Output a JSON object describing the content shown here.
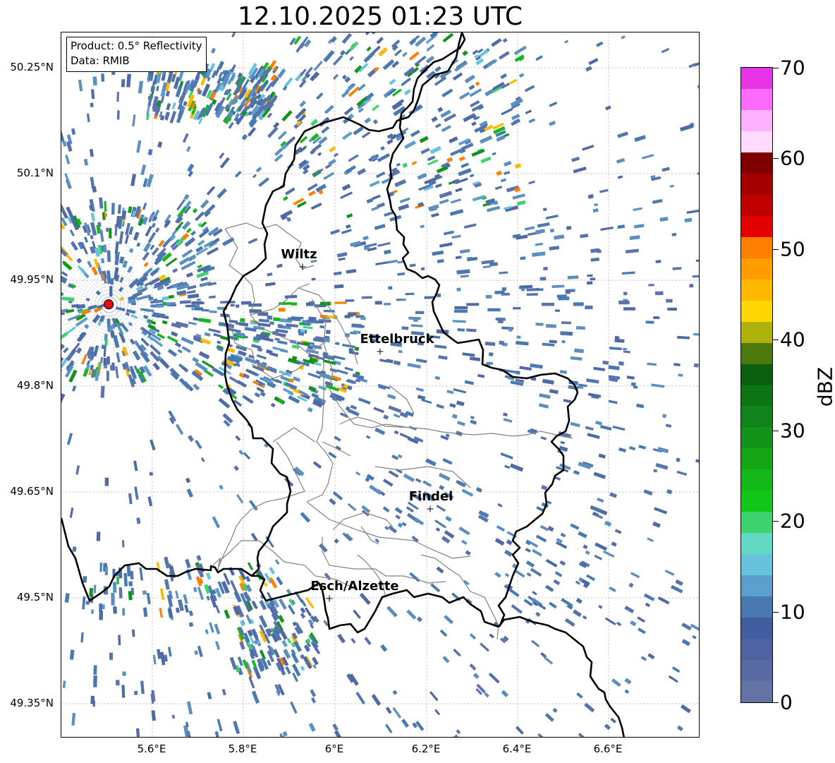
{
  "title": "12.10.2025 01:23 UTC",
  "info": {
    "product": "Product: 0.5° Reflectivity",
    "source": "Data: RMIB"
  },
  "axes": {
    "lat_labels": [
      "50.25°N",
      "50.1°N",
      "49.95°N",
      "49.8°N",
      "49.65°N",
      "49.5°N",
      "49.35°N"
    ],
    "lon_labels": [
      "5.6°E",
      "5.8°E",
      "6°E",
      "6.2°E",
      "6.4°E",
      "6.6°E"
    ]
  },
  "cities": [
    {
      "name": "Wiltz"
    },
    {
      "name": "Ettelbruck"
    },
    {
      "name": "Findel"
    },
    {
      "name": "Esch/Alzette"
    }
  ],
  "colorbar": {
    "unit": "dBZ",
    "tick_labels": [
      "70",
      "60",
      "50",
      "40",
      "30",
      "20",
      "10",
      "0"
    ],
    "colors": [
      "#6473a6",
      "#5a6aa4",
      "#4f62a2",
      "#415ea0",
      "#4a78b0",
      "#5ba0cc",
      "#67c2dc",
      "#63d9c4",
      "#3fd36f",
      "#12c61a",
      "#14b818",
      "#14a514",
      "#12941a",
      "#10841a",
      "#0d7414",
      "#0b5f0f",
      "#4c7a0d",
      "#b0b20c",
      "#ffd600",
      "#ffb800",
      "#ff9c00",
      "#ff7f00",
      "#e50000",
      "#c00000",
      "#a40000",
      "#7f0000",
      "#ffdcff",
      "#ffb0ff",
      "#ff6aff",
      "#e634e6"
    ]
  },
  "colors": {
    "country_border": "#000000",
    "canton_border": "#808080",
    "grid": "#bbbbbb",
    "radar_site": "#e01010"
  }
}
